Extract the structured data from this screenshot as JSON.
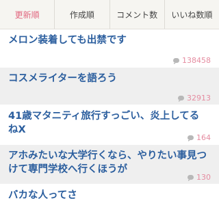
{
  "tabs": [
    {
      "label": "更新順",
      "active": true
    },
    {
      "label": "作成順",
      "active": false
    },
    {
      "label": "コメント数",
      "active": false
    },
    {
      "label": "いいね数順",
      "active": false
    }
  ],
  "topics": [
    {
      "title": "メロン装着しても出禁です",
      "comments": "138458"
    },
    {
      "title": "コスメライターを語ろう",
      "comments": "32913"
    },
    {
      "title": "41歳マタニティ旅行すっごい、炎上してるねX",
      "comments": "164"
    },
    {
      "title": "アホみたいな大学行くなら、やりたい事見つけて専門学校へ行くほうが",
      "comments": "130"
    },
    {
      "title": "バカな人ってさ",
      "comments": ""
    }
  ],
  "colors": {
    "accent": "#e1677f",
    "title": "#2b5e9e",
    "count": "#e58ca0"
  },
  "icons": {
    "comment": "speech-bubble-icon"
  }
}
